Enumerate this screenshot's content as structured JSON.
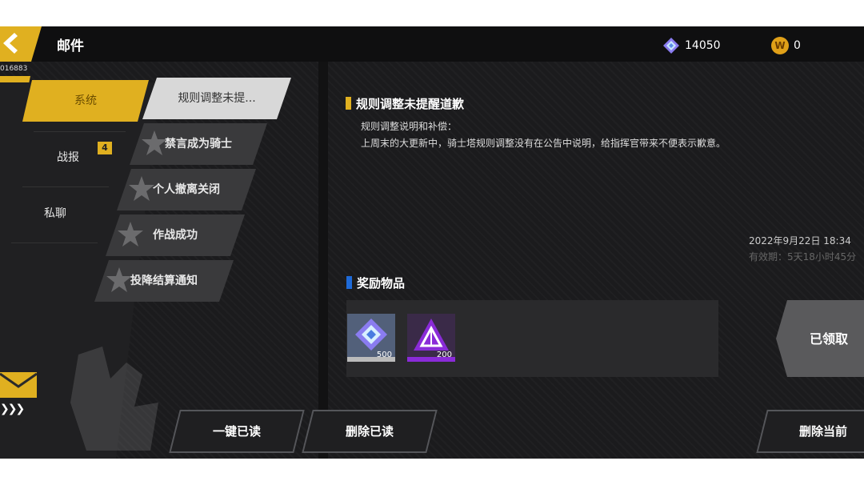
{
  "header": {
    "title": "邮件",
    "diamond_count": "14050",
    "coin_count": "0",
    "coin_symbol": "W"
  },
  "uid": "016883",
  "categories": [
    {
      "label": "系统",
      "active": true
    },
    {
      "label": "战报",
      "badge": "4"
    },
    {
      "label": "私聊"
    }
  ],
  "mails": [
    {
      "label": "规则调整未提..."
    },
    {
      "label": "禁言成为骑士"
    },
    {
      "label": "个人撤离关闭"
    },
    {
      "label": "作战成功"
    },
    {
      "label": "投降结算通知"
    }
  ],
  "mail_detail": {
    "title": "规则调整未提醒道歉",
    "body_lines": [
      "规则调整说明和补偿：",
      "上周末的大更新中，骑士塔规则调整没有在公告中说明，给指挥官带来不便表示歉意。"
    ],
    "date": "2022年9月22日  18:34",
    "validity": "有效期：5天18小时45分",
    "rewards_title": "奖励物品",
    "rewards": [
      {
        "name": "diamond",
        "count": "500"
      },
      {
        "name": "purple-crystal",
        "count": "200"
      }
    ],
    "claimed_label": "已领取"
  },
  "buttons": {
    "read_all": "一键已读",
    "delete_read": "删除已读",
    "delete_current": "删除当前"
  },
  "colors": {
    "accent": "#e0b020",
    "title_mark": "#e0b020",
    "rewards_mark": "#1e6ad8",
    "purple": "#8a2bd8"
  }
}
